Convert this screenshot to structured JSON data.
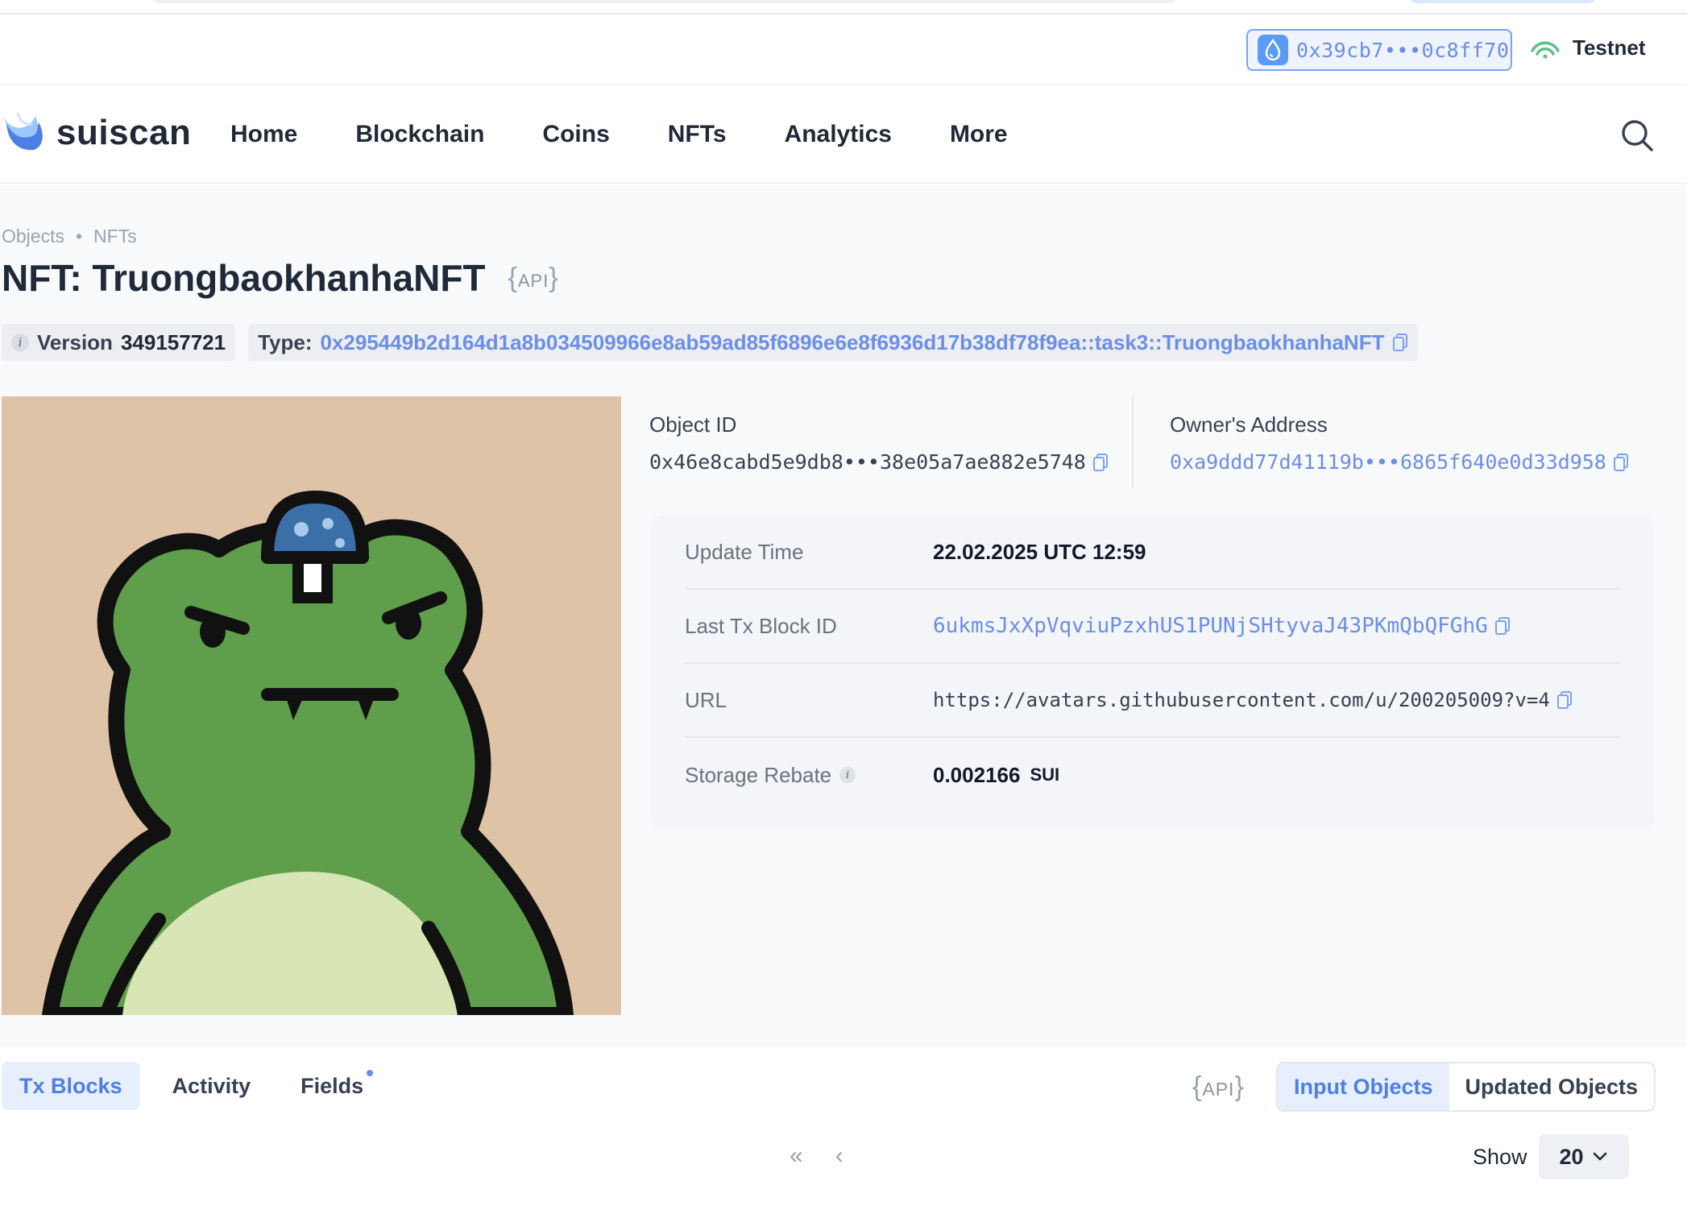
{
  "wallet": {
    "address": "0x39cb7•••0c8ff70",
    "network": "Testnet"
  },
  "nav": {
    "logo": "suiscan",
    "links": [
      "Home",
      "Blockchain",
      "Coins",
      "NFTs",
      "Analytics",
      "More"
    ]
  },
  "breadcrumb": {
    "items": [
      "Objects",
      "NFTs"
    ],
    "separator": "•"
  },
  "page": {
    "title": "NFT: TruongbaokhanhaNFT",
    "api_label": "API"
  },
  "meta": {
    "version_label": "Version",
    "version_value": "349157721",
    "type_label": "Type:",
    "type_value": "0x295449b2d164d1a8b034509966e8ab59ad85f6896e6e8f6936d17b38df78f9ea::task3::TruongbaokhanhaNFT"
  },
  "object": {
    "id_label": "Object ID",
    "id_value": "0x46e8cabd5e9db8•••38e05a7ae882e5748",
    "owner_label": "Owner's Address",
    "owner_value": "0xa9ddd77d41119b•••6865f640e0d33d958"
  },
  "details": {
    "update_time_label": "Update Time",
    "update_time_value": "22.02.2025 UTC 12:59",
    "last_tx_label": "Last Tx Block ID",
    "last_tx_value": "6ukmsJxXpVqviuPzxhUS1PUNjSHtyvaJ43PKmQbQFGhG",
    "url_label": "URL",
    "url_value": "https://avatars.githubusercontent.com/u/200205009?v=4",
    "storage_label": "Storage Rebate",
    "storage_value": "0.002166",
    "storage_unit": "SUI"
  },
  "tabs": [
    "Tx Blocks",
    "Activity",
    "Fields"
  ],
  "active_tab": "Tx Blocks",
  "api_label_2": "API",
  "segment": {
    "options": [
      "Input Objects",
      "Updated Objects"
    ],
    "active": "Input Objects"
  },
  "pagination": {
    "first": "«",
    "prev": "‹"
  },
  "show": {
    "label": "Show",
    "value": "20"
  },
  "colors": {
    "accent": "#6b8ee8",
    "frog_green": "#5f9e4a",
    "background_tan": "#dfc3a6"
  }
}
